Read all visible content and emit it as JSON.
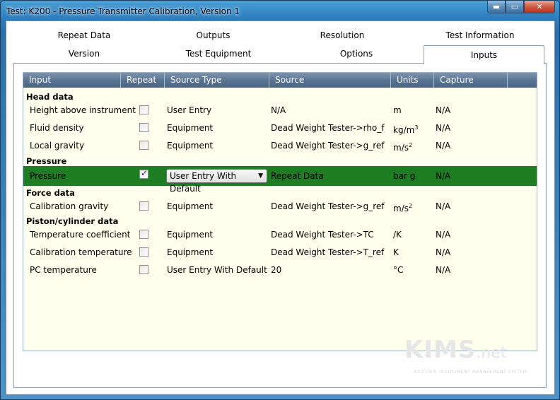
{
  "window": {
    "title": "Test: K200 - Pressure Transmitter Calibration, Version 1",
    "controls": {
      "minimize": "▬",
      "maximize": "▭",
      "close": "✕"
    }
  },
  "tabs": {
    "row1": [
      "Repeat Data",
      "Outputs",
      "Resolution",
      "Test Information"
    ],
    "row2": [
      "Version",
      "Test Equipment",
      "Options",
      "Inputs"
    ],
    "active": "Inputs"
  },
  "grid": {
    "headers": [
      "Input",
      "Repeat",
      "Source Type",
      "Source",
      "Units",
      "Capture"
    ],
    "groups": {
      "head": "Head data",
      "pressure": "Pressure",
      "force": "Force data",
      "piston": "Piston/cylinder data"
    },
    "rows": [
      {
        "input": "Height above instrument",
        "repeat": false,
        "source_type": "User Entry",
        "source": "N/A",
        "units": "m",
        "capture": "N/A"
      },
      {
        "input": "Fluid density",
        "repeat": false,
        "source_type": "Equipment",
        "source": "Dead Weight Tester->rho_f",
        "units_base": "kg/m",
        "units_sup": "3",
        "capture": "N/A"
      },
      {
        "input": "Local gravity",
        "repeat": false,
        "source_type": "Equipment",
        "source": "Dead Weight Tester->g_ref",
        "units_base": "m/s",
        "units_sup": "2",
        "capture": "N/A"
      },
      {
        "input": "Pressure",
        "repeat": true,
        "source_type": "User Entry With Default",
        "source": "Repeat Data",
        "units": "bar g",
        "capture": "N/A",
        "selected": true
      },
      {
        "input": "Calibration gravity",
        "repeat": false,
        "source_type": "Equipment",
        "source": "Dead Weight Tester->g_ref",
        "units_base": "m/s",
        "units_sup": "2",
        "capture": "N/A"
      },
      {
        "input": "Temperature coefficient",
        "repeat": false,
        "source_type": "Equipment",
        "source": "Dead Weight Tester->TC",
        "units": "/K",
        "capture": "N/A"
      },
      {
        "input": "Calibration temperature",
        "repeat": false,
        "source_type": "Equipment",
        "source": "Dead Weight Tester->T_ref",
        "units": "K",
        "capture": "N/A"
      },
      {
        "input": "PC temperature",
        "repeat": false,
        "source_type": "User Entry With Default",
        "source": "20",
        "units": "°C",
        "capture": "N/A"
      }
    ],
    "combo_arrow": "▼"
  },
  "logo": {
    "main": "KIMS",
    "net": ".net",
    "tagline": "KELTON® INSTRUMENT MANAGEMENT SYSTEM"
  },
  "colors": {
    "selected_row": "#1e7d22",
    "grid_bg": "#ffffed",
    "header_bg": "#5a7493"
  }
}
